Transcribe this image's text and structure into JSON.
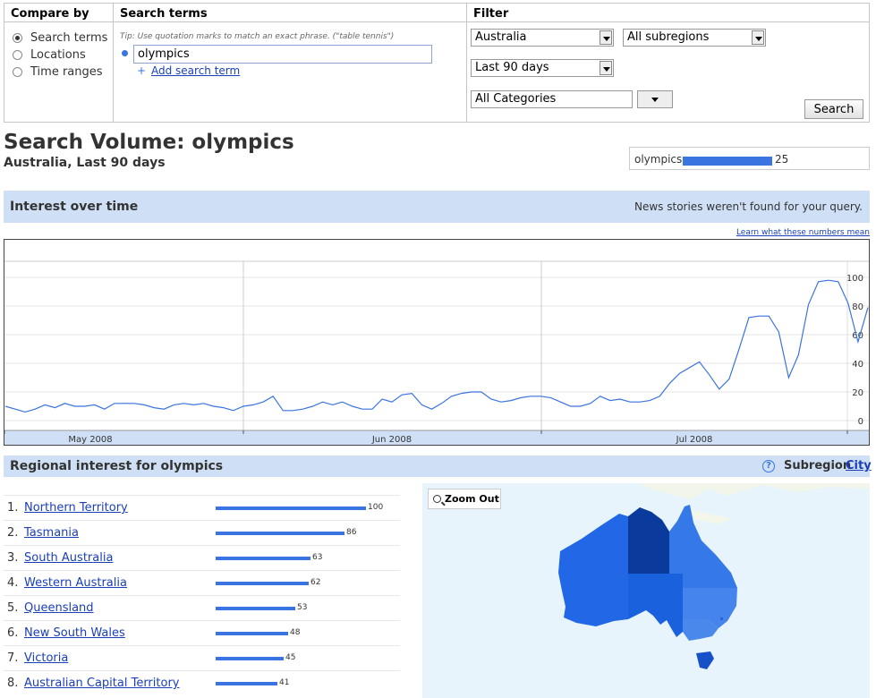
{
  "compare": {
    "heading": "Compare by",
    "options": [
      {
        "label": "Search terms",
        "selected": true
      },
      {
        "label": "Locations",
        "selected": false
      },
      {
        "label": "Time ranges",
        "selected": false
      }
    ]
  },
  "terms": {
    "heading": "Search terms",
    "tip": "Tip: Use quotation marks to match an exact phrase. (\"table tennis\")",
    "term_value": "olympics",
    "add_label": "Add search term",
    "add_symbol": "+"
  },
  "filter": {
    "heading": "Filter",
    "country": "Australia",
    "subregion": "All subregions",
    "period": "Last 90 days",
    "category": "All Categories",
    "search_button": "Search"
  },
  "heading": {
    "title": "Search Volume: olympics",
    "subtitle": "Australia, Last 90 days"
  },
  "legend": {
    "term": "olympics",
    "value": "25",
    "fraction": 0.25
  },
  "interest": {
    "title": "Interest over time",
    "news_message": "News stories weren't found for your query.",
    "learn_link": "Learn what these numbers mean"
  },
  "chart_data": {
    "type": "line",
    "xlabel": "",
    "ylabel": "",
    "ylim": [
      0,
      100
    ],
    "ytick_labels": [
      "100",
      "80",
      "60",
      "40",
      "20",
      "0"
    ],
    "month_labels": [
      "May 2008",
      "Jun 2008",
      "Jul 2008"
    ],
    "grid": true,
    "series_color": "#3a74e0",
    "series": [
      {
        "values": [
          10,
          8,
          6,
          8,
          11,
          9,
          12,
          10,
          10,
          11,
          8,
          12,
          12,
          12,
          11,
          9,
          8,
          11,
          12,
          11,
          12,
          10,
          9,
          7,
          10,
          11,
          13,
          17,
          7,
          7,
          8,
          10,
          13,
          11,
          13,
          10,
          8,
          8,
          15,
          13,
          18,
          19,
          11,
          8,
          12,
          17,
          19,
          20,
          20,
          15,
          13,
          14,
          16,
          17,
          17,
          16,
          13,
          10,
          10,
          12,
          17,
          14,
          15,
          13,
          13,
          14,
          17,
          26,
          33,
          37,
          41,
          32,
          22,
          29,
          50,
          72,
          73,
          73,
          62,
          30,
          46,
          81,
          97,
          98,
          97,
          82,
          55,
          79
        ]
      }
    ]
  },
  "regional": {
    "title": "Regional interest  for olympics",
    "help_symbol": "?",
    "subregion_label": "Subregion",
    "city_label": "City",
    "rows": [
      {
        "rank": "1.",
        "name": "Northern Territory",
        "value": 100
      },
      {
        "rank": "2.",
        "name": "Tasmania",
        "value": 86
      },
      {
        "rank": "3.",
        "name": "South Australia",
        "value": 63
      },
      {
        "rank": "4.",
        "name": "Western Australia",
        "value": 62
      },
      {
        "rank": "5.",
        "name": "Queensland",
        "value": 53
      },
      {
        "rank": "6.",
        "name": "New South Wales",
        "value": 48
      },
      {
        "rank": "7.",
        "name": "Victoria",
        "value": 45
      },
      {
        "rank": "8.",
        "name": "Australian Capital Territory",
        "value": 41
      }
    ]
  },
  "map": {
    "zoom_label": "Zoom Out",
    "colors": {
      "nt": "#0a3a9c",
      "tas": "#1550c8",
      "sa": "#1a62dd",
      "wa": "#2167e6",
      "qld": "#3578e8",
      "nsw": "#4484ec",
      "vic": "#4a88ec",
      "ocean": "#e8f4fb"
    }
  }
}
